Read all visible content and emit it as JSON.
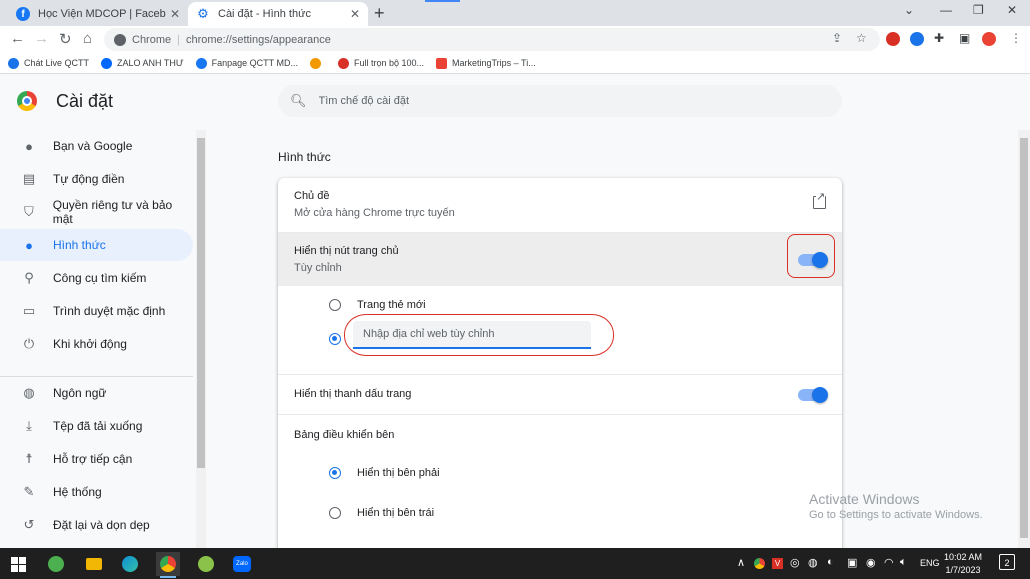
{
  "browser": {
    "tabs": [
      {
        "title": "Học Viện MDCOP | Facebook",
        "favicon": "facebook-icon"
      },
      {
        "title": "Cài đặt - Hình thức",
        "favicon": "gear-icon"
      }
    ],
    "omnibox": {
      "chip": "Chrome",
      "url": "chrome://settings/appearance"
    },
    "bookmarks": [
      {
        "label": "Chát Live QCTT",
        "icon": "bookmark-icon",
        "color": "#1a73e8"
      },
      {
        "label": "ZALO ANH THƯ",
        "icon": "zalo-icon",
        "color": "#0068ff"
      },
      {
        "label": "Fanpage QCTT MD...",
        "icon": "facebook-icon",
        "color": "#1877f2"
      },
      {
        "label": "",
        "icon": "emoji-icon",
        "color": "#f29900"
      },
      {
        "label": "Full trọn bộ 100...",
        "icon": "heart-icon",
        "color": "#d93025"
      },
      {
        "label": "MarketingTrips – Ti...",
        "icon": "m-icon",
        "color": "#ea4335"
      }
    ]
  },
  "settings": {
    "title": "Cài đặt",
    "search_placeholder": "Tìm chế độ cài đặt",
    "nav": [
      {
        "label": "Bạn và Google",
        "icon": "person-icon"
      },
      {
        "label": "Tự động điền",
        "icon": "clipboard-icon"
      },
      {
        "label": "Quyền riêng tư và bảo mật",
        "icon": "shield-icon"
      },
      {
        "label": "Hình thức",
        "icon": "palette-icon",
        "active": true
      },
      {
        "label": "Công cụ tìm kiếm",
        "icon": "search-icon"
      },
      {
        "label": "Trình duyệt mặc định",
        "icon": "browser-icon"
      },
      {
        "label": "Khi khởi động",
        "icon": "power-icon"
      },
      {
        "label": "Ngôn ngữ",
        "icon": "globe-icon"
      },
      {
        "label": "Tệp đã tải xuống",
        "icon": "download-icon"
      },
      {
        "label": "Hỗ trợ tiếp cận",
        "icon": "accessibility-icon"
      },
      {
        "label": "Hệ thống",
        "icon": "wrench-icon"
      },
      {
        "label": "Đặt lại và dọn dẹp",
        "icon": "restore-icon"
      }
    ],
    "section_title": "Hình thức",
    "theme": {
      "label": "Chủ đề",
      "sublabel": "Mở cửa hàng Chrome trực tuyến"
    },
    "home_button": {
      "label": "Hiển thị nút trang chủ",
      "sublabel": "Tùy chỉnh",
      "enabled": true
    },
    "home_options": [
      {
        "label": "Trang thẻ mới",
        "checked": false
      }
    ],
    "custom_url_placeholder": "Nhập địa chỉ web tùy chỉnh",
    "bookmarks_bar": {
      "label": "Hiển thị thanh dấu trang",
      "enabled": true
    },
    "side_panel": {
      "label": "Bảng điều khiển bên",
      "options": [
        {
          "label": "Hiển thị bên phải",
          "checked": true
        },
        {
          "label": "Hiển thị bên trái",
          "checked": false
        }
      ]
    }
  },
  "watermark": {
    "line1": "Activate Windows",
    "line2": "Go to Settings to activate Windows."
  },
  "taskbar": {
    "apps": [
      "windows-start-icon",
      "snipping-icon",
      "file-explorer-icon",
      "edge-icon",
      "chrome-icon",
      "app-green-icon",
      "zalo-icon"
    ],
    "zalo_label": "Zalo",
    "language": "ENG",
    "time": "10:02 AM",
    "date": "1/7/2023",
    "notifications": "2"
  },
  "colors": {
    "accent": "#1a73e8",
    "annotation": "#d93025"
  }
}
